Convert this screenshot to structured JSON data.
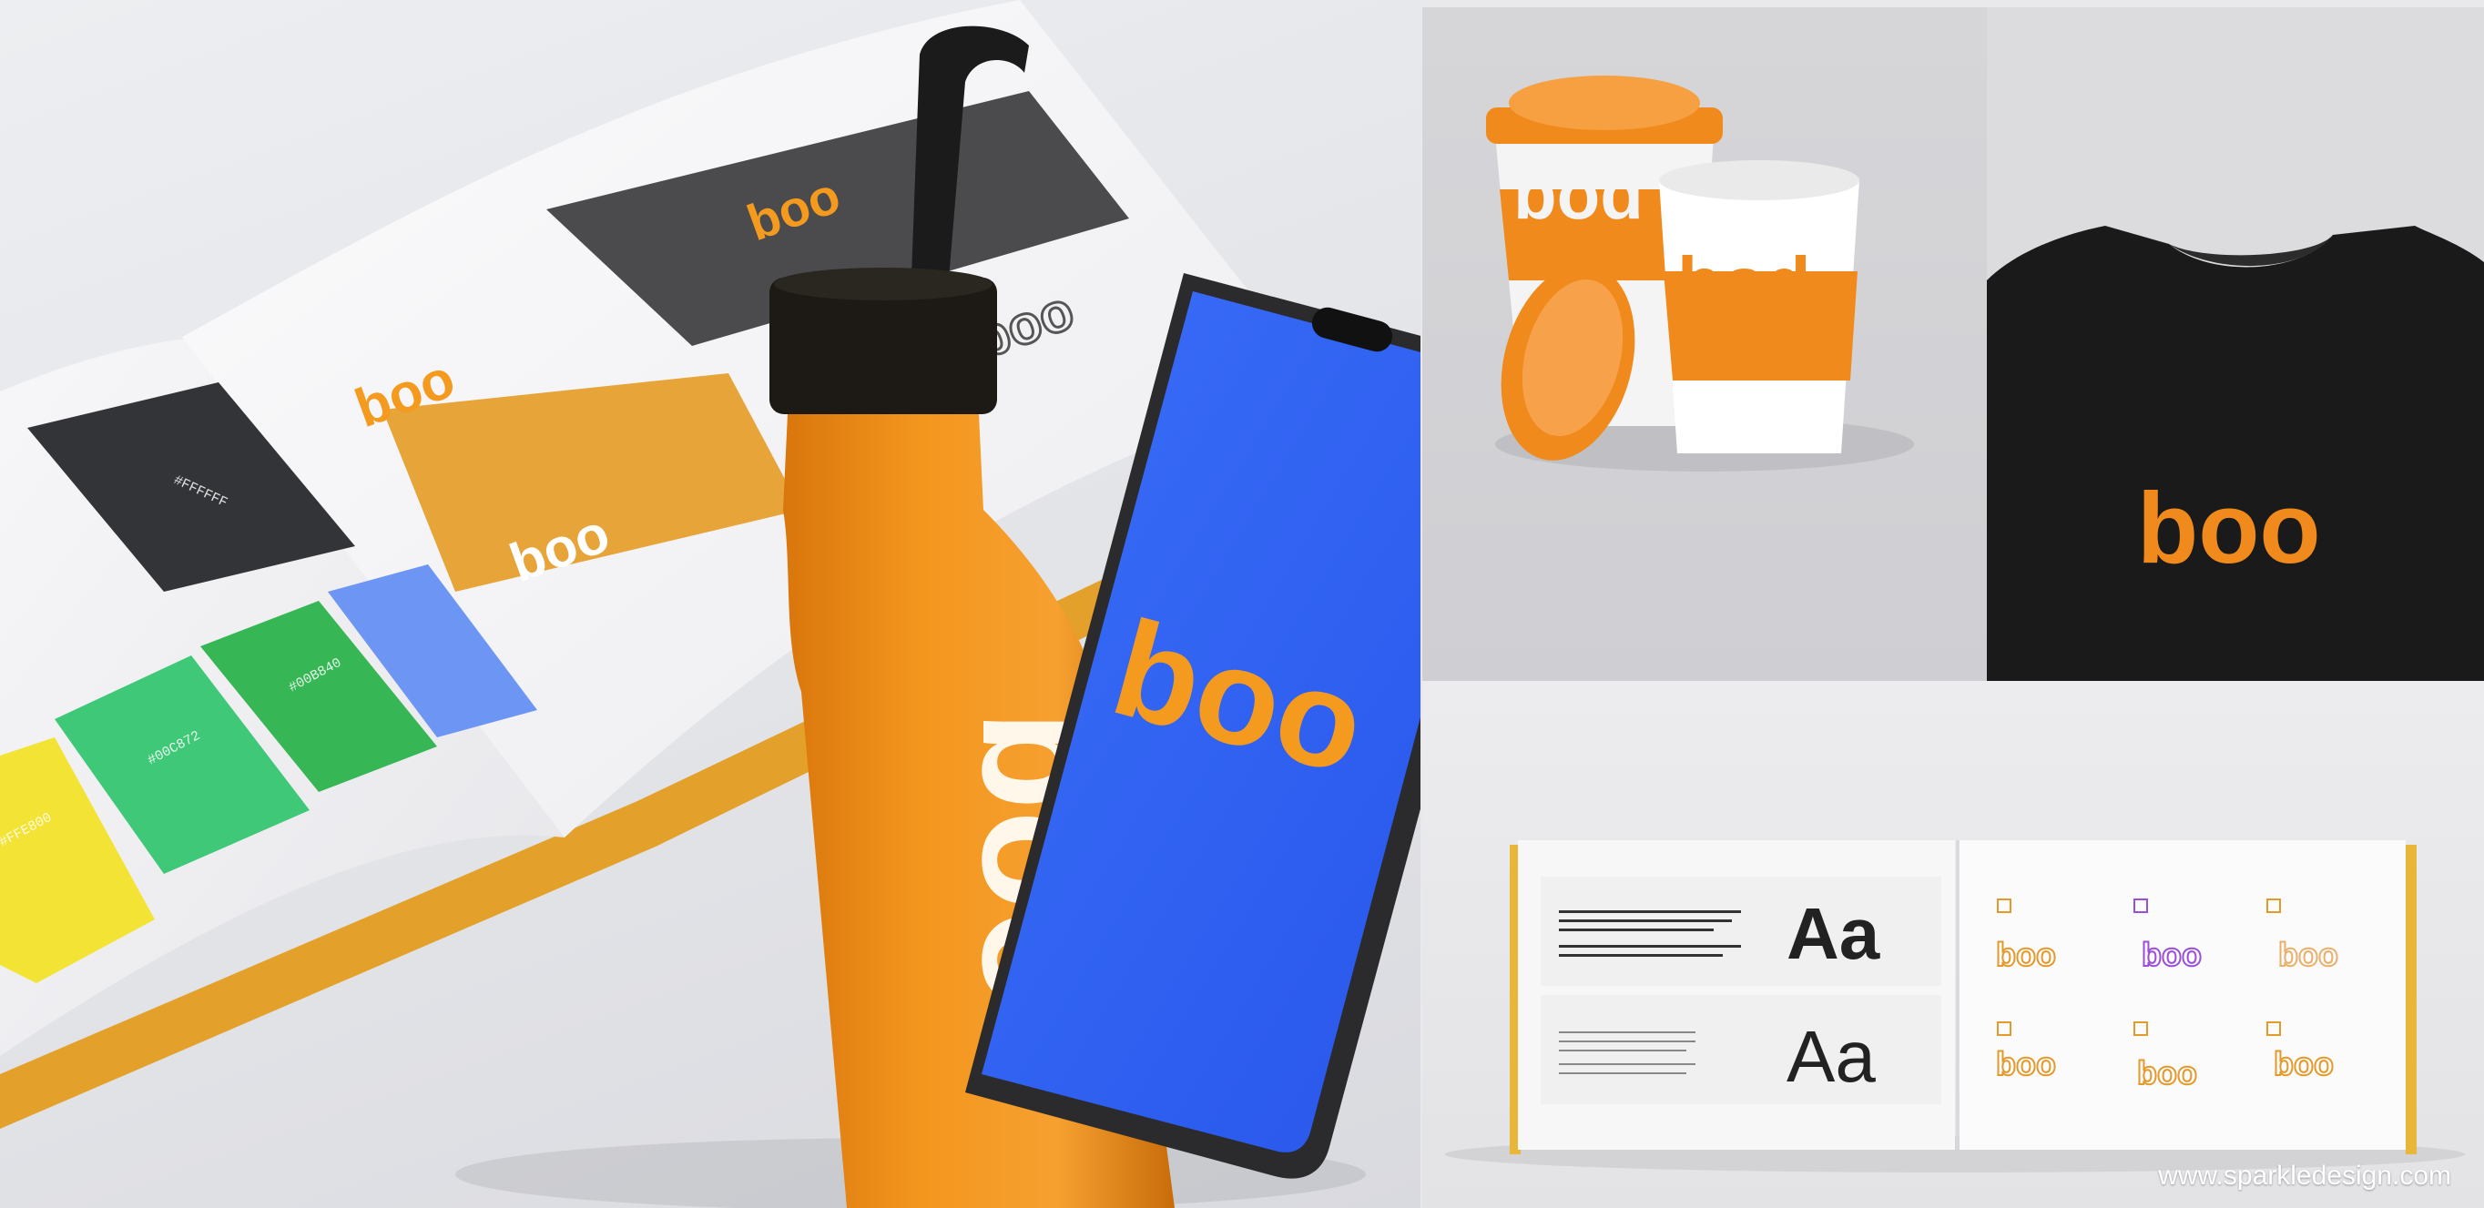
{
  "brand": {
    "name": "boo",
    "orange": "#F39A1F",
    "blue": "#2F64F5",
    "black": "#1d1d1d",
    "charcoal": "#4a4a4a"
  },
  "brandbook_left": {
    "swatches": [
      {
        "code": "#FFE800",
        "color": "#F2E334"
      },
      {
        "code": "#00C872",
        "color": "#3FC877"
      },
      {
        "code": "#00B840",
        "color": "#36B654"
      },
      {
        "code": "",
        "color": "#6C95F4"
      }
    ],
    "dark_swatch_code": "#FFFFFF"
  },
  "bottle": {
    "logo": "boo"
  },
  "phone": {
    "logo": "boo"
  },
  "cups": {
    "logo_cup1": "bod",
    "logo_cup2": "bod"
  },
  "shirt": {
    "logo": "boo"
  },
  "guide_book": {
    "sample_large_1": "Aa",
    "sample_large_2": "Aa",
    "logo_variants": [
      "boo",
      "boo",
      "boo",
      "boo",
      "boo",
      "boo"
    ]
  },
  "footer": {
    "url": "www.sparkledesign.com"
  },
  "icons": [
    "water-bottle-icon",
    "smartphone-icon",
    "coffee-cup-icon",
    "tshirt-icon"
  ]
}
